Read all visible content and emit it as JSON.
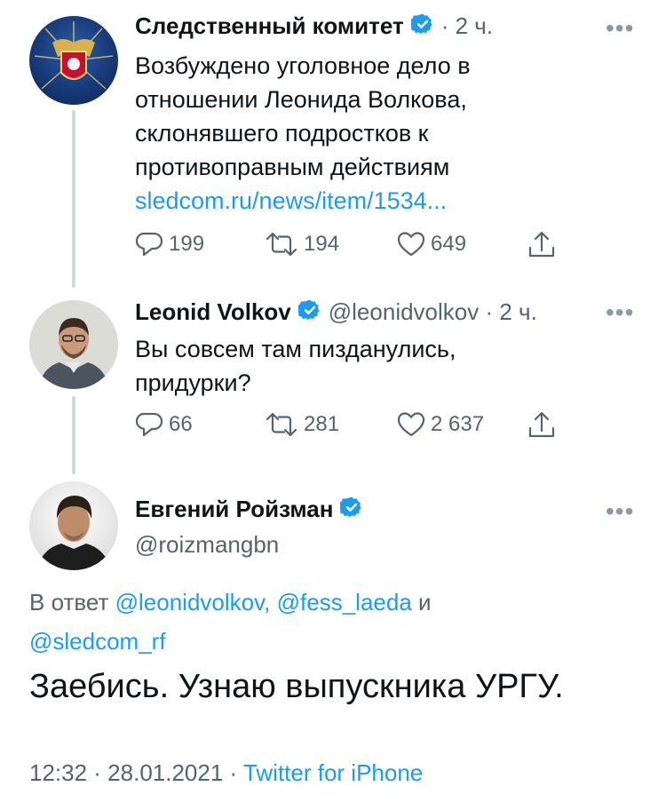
{
  "tweets": [
    {
      "name": "Следственный комитет",
      "handle": "",
      "time": "· 2 ч.",
      "text_lines": [
        "Возбуждено уголовное дело в",
        "отношении Леонида Волкова,",
        "склонявшего подростков к",
        "противоправным действиям"
      ],
      "link": "sledcom.ru/news/item/1534...",
      "replies": "199",
      "retweets": "194",
      "likes": "649"
    },
    {
      "name": "Leonid Volkov",
      "handle": "@leonidvolkov · 2 ч.",
      "text_lines": [
        "Вы совсем там пизданулись,",
        "придурки?"
      ],
      "replies": "66",
      "retweets": "281",
      "likes": "2 637"
    }
  ],
  "main_tweet": {
    "name": "Евгений Ройзман",
    "handle": "@roizmangbn",
    "reply_prefix": "В ответ",
    "reply_to_1": "@leonidvolkov, @fess_laeda",
    "reply_and": "и",
    "reply_to_2": "@sledcom_rf",
    "text": "Заебись. Узнаю выпускника УРГУ.",
    "timestamp": "12:32 · 28.01.2021 ·",
    "source": "Twitter for iPhone"
  },
  "colors": {
    "accent": "#1d9bf0",
    "secondary_text": "#536471",
    "thread_line": "#cfd9de"
  },
  "icons": [
    "verified-badge-icon",
    "more-icon",
    "reply-icon",
    "retweet-icon",
    "like-icon",
    "share-icon"
  ]
}
